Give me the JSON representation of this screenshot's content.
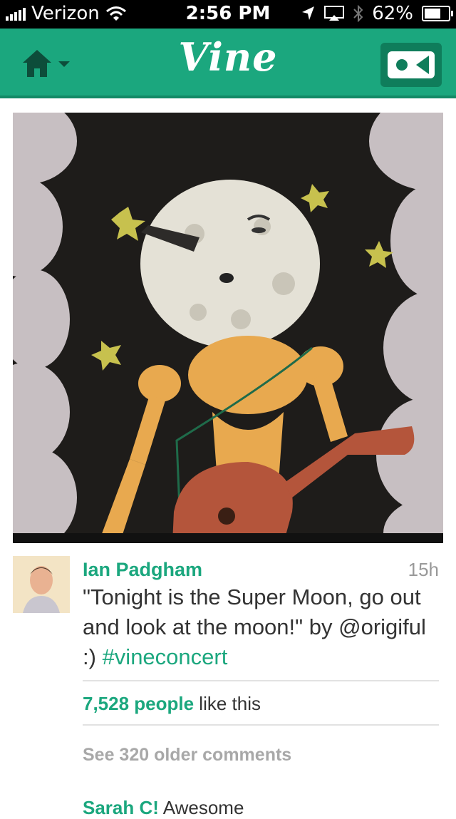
{
  "status_bar": {
    "carrier": "Verizon",
    "time": "2:56 PM",
    "battery": "62%",
    "battery_level": 0.62
  },
  "nav": {
    "logo": "Vine",
    "home_icon": "home-icon",
    "record_icon": "video-camera-icon",
    "colors": {
      "brand": "#1ba77e",
      "brand_dark": "#0f7d5b"
    }
  },
  "post": {
    "author": "Ian Padgham",
    "time_ago": "15h",
    "caption_text": "\"Tonight is the Super Moon, go out and look at the moon!\" by ",
    "caption_mention": "@origiful :)",
    "caption_hashtag": "#vineconcert",
    "likes_count": "7,528 people",
    "likes_suffix": " like this",
    "older_comments": "See 320 older comments",
    "comment": {
      "name": "Sarah C!",
      "text": " Awesome"
    }
  }
}
